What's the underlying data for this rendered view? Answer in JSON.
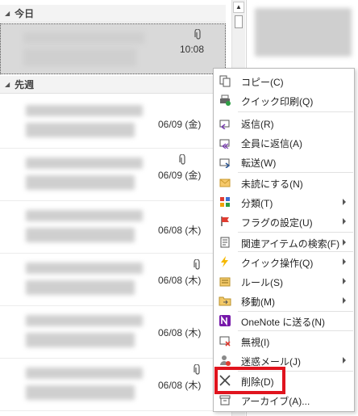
{
  "groups": {
    "today": "今日",
    "last_week": "先週"
  },
  "mail_items": [
    {
      "time": "10:08"
    },
    {
      "date": "06/09 (金)"
    },
    {
      "date": "06/09 (金)"
    },
    {
      "date": "06/08 (木)"
    },
    {
      "date": "06/08 (木)"
    },
    {
      "date": "06/08 (木)"
    },
    {
      "date": "06/08 (木)"
    }
  ],
  "context_menu": {
    "copy": "コピー(C)",
    "quick_print": "クイック印刷(Q)",
    "reply": "返信(R)",
    "reply_all": "全員に返信(A)",
    "forward": "転送(W)",
    "mark_unread": "未読にする(N)",
    "categorize": "分類(T)",
    "follow_up": "フラグの設定(U)",
    "find_related": "関連アイテムの検索(F)",
    "quick_steps": "クイック操作(Q)",
    "rules": "ルール(S)",
    "move": "移動(M)",
    "onenote": "OneNote に送る(N)",
    "ignore": "無視(I)",
    "junk": "迷惑メール(J)",
    "delete": "削除(D)",
    "archive": "アーカイブ(A)..."
  },
  "colors": {
    "highlight": "#e0141e",
    "selected_bg": "#d9d9d9"
  }
}
